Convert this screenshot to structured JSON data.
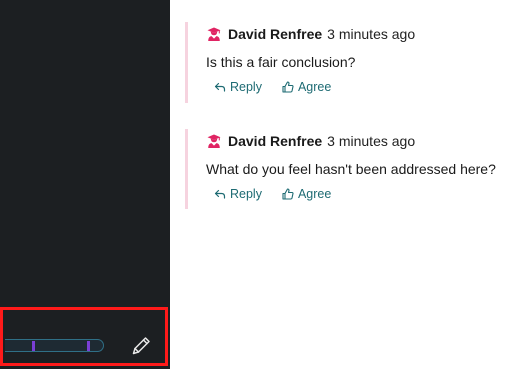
{
  "sidebar": {
    "edit_icon": "pencil-icon",
    "progress": {
      "marker_positions_percent": [
        28,
        84
      ]
    },
    "colors": {
      "background": "#1c1f22",
      "highlight_border": "#ff1a1a",
      "marker": "#7a3fd6"
    }
  },
  "comments": [
    {
      "author": "David Renfree",
      "time": "3 minutes ago",
      "text": "Is this a fair conclusion?",
      "reply_label": "Reply",
      "agree_label": "Agree"
    },
    {
      "author": "David Renfree",
      "time": "3 minutes ago",
      "text": "What do you feel hasn't been addressed here?",
      "reply_label": "Reply",
      "agree_label": "Agree"
    }
  ],
  "colors": {
    "accent": "#1e6b73",
    "avatar": "#e02463",
    "comment_border": "#f6d3df"
  }
}
